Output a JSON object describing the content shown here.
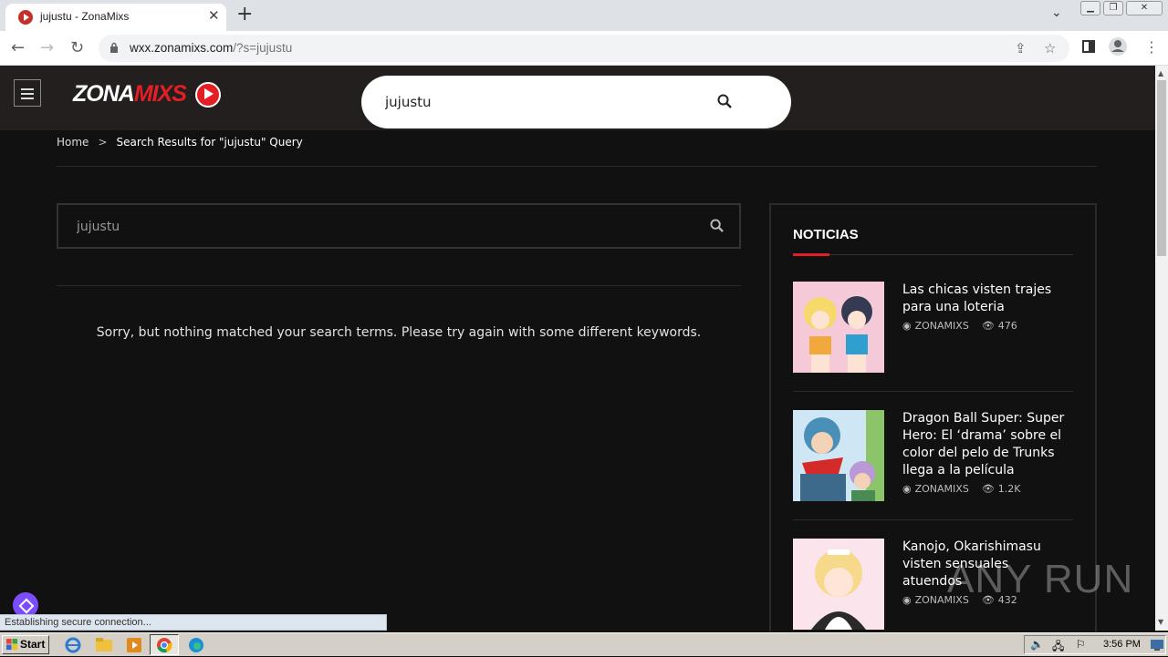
{
  "browser": {
    "tab_title": "jujustu - ZonaMixs",
    "url_host": "wxx.zonamixs.com",
    "url_path": "/?s=jujustu",
    "status_text": "Establishing secure connection..."
  },
  "site": {
    "logo_main": "ZONA",
    "logo_accent": "MIXS",
    "header_search_value": "jujustu",
    "accent_color": "#e31e24"
  },
  "breadcrumb": {
    "home": "Home",
    "separator": ">",
    "current": "Search Results for \"jujustu\" Query"
  },
  "main": {
    "search_value": "jujustu",
    "no_results": "Sorry, but nothing matched your search terms. Please try again with some different keywords."
  },
  "sidebar": {
    "title": "NOTICIAS",
    "posts": [
      {
        "title": "Las chicas visten trajes para una loteria",
        "author": "ZONAMIXS",
        "views": "476"
      },
      {
        "title": "Dragon Ball Super: Super Hero: El ‘drama’ sobre el color del pelo de Trunks llega a la película",
        "author": "ZONAMIXS",
        "views": "1.2K"
      },
      {
        "title": "Kanojo, Okarishimasu visten sensuales atuendos",
        "author": "ZONAMIXS",
        "views": "432"
      }
    ]
  },
  "watermark": "ANY RUN",
  "taskbar": {
    "start_label": "Start",
    "clock": "3:56 PM"
  }
}
